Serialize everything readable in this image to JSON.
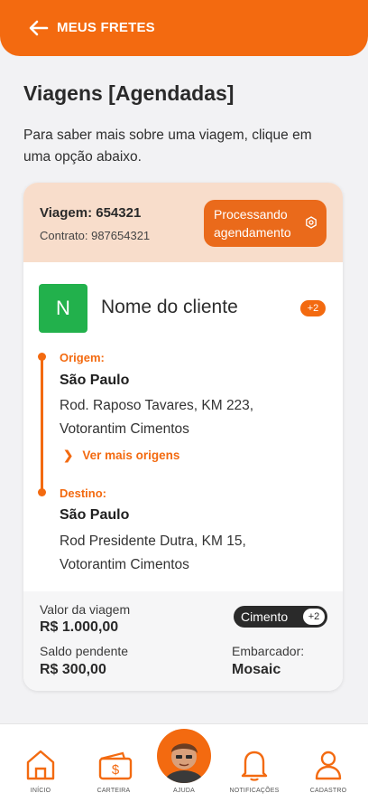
{
  "header": {
    "back_icon": "arrow-left-icon",
    "title": "MEUS FRETES"
  },
  "page": {
    "title": "Viagens [Agendadas]",
    "subtitle": "Para saber mais sobre uma viagem, clique em uma opção abaixo."
  },
  "trip": {
    "id_label": "Viagem: 654321",
    "contract_label": "Contrato: 987654321",
    "status": "Processando agendamento",
    "status_icon": "hexagon-gear-icon",
    "client_initial": "N",
    "client_name": "Nome do cliente",
    "client_extra": "+2",
    "origin": {
      "label": "Origem:",
      "city": "São Paulo",
      "address_line1": "Rod. Raposo Tavares, KM 223,",
      "address_line2": "Votorantim Cimentos",
      "more_link": "Ver mais origens"
    },
    "destination": {
      "label": "Destino:",
      "city": "São Paulo",
      "address_line1": "Rod Presidente Dutra, KM 15,",
      "address_line2": "Votorantim Cimentos"
    },
    "footer": {
      "value_label": "Valor da viagem",
      "value": "R$ 1.000,00",
      "balance_label": "Saldo pendente",
      "balance": "R$ 300,00",
      "cargo_tag": "Cimento",
      "cargo_extra": "+2",
      "shipper_label": "Embarcador:",
      "shipper": "Mosaic"
    }
  },
  "nav": {
    "items": [
      {
        "label": "INÍCIO",
        "icon": "home-icon"
      },
      {
        "label": "CARTEIRA",
        "icon": "wallet-icon"
      },
      {
        "label": "AJUDA",
        "icon": "help-avatar-icon"
      },
      {
        "label": "NOTIFICAÇÕES",
        "icon": "bell-icon"
      },
      {
        "label": "CADASTRO",
        "icon": "user-icon"
      }
    ]
  },
  "colors": {
    "accent": "#f36a10",
    "status_bg": "#ea6a1b",
    "header_tint": "#f8ddcb",
    "client_avatar": "#22b14c"
  }
}
